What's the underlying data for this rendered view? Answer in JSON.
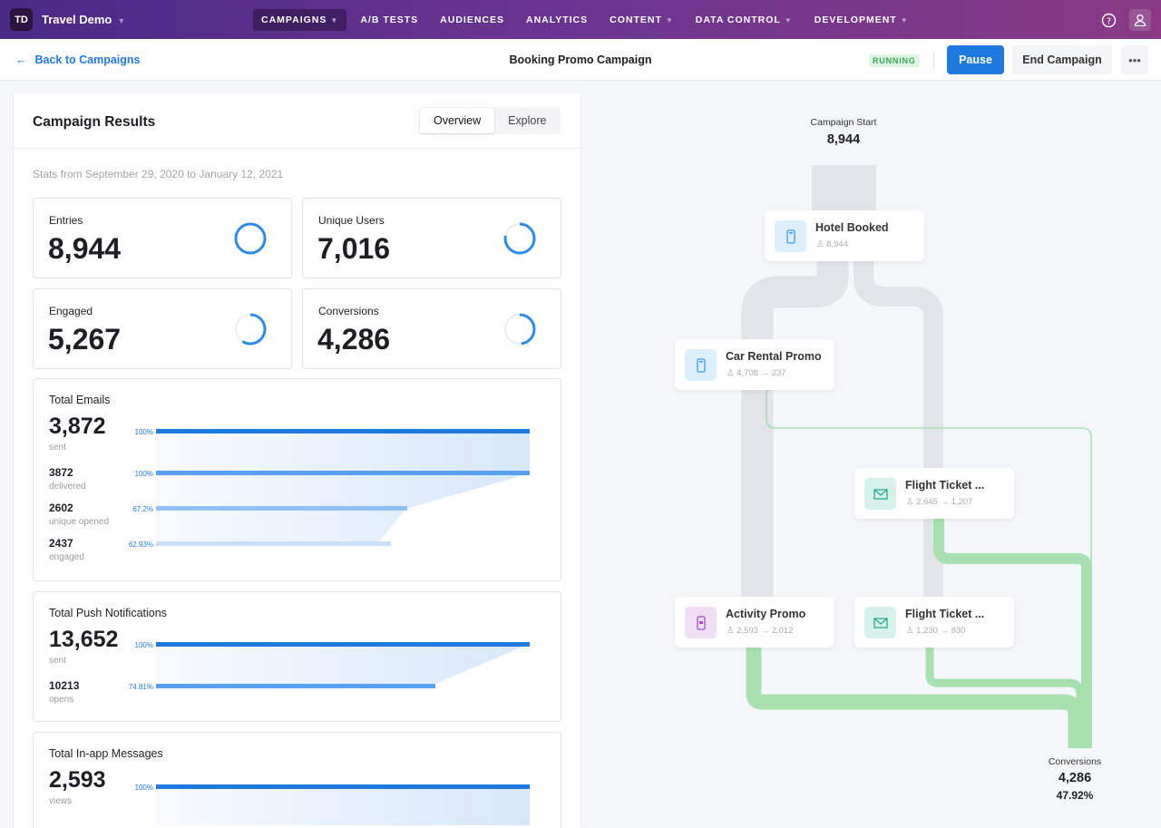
{
  "topbar": {
    "logo": "TD",
    "app": "Travel Demo",
    "nav": [
      "CAMPAIGNS",
      "A/B TESTS",
      "AUDIENCES",
      "ANALYTICS",
      "CONTENT",
      "DATA CONTROL",
      "DEVELOPMENT"
    ],
    "nav_dropdowns": [
      true,
      false,
      false,
      false,
      true,
      true,
      true
    ]
  },
  "subbar": {
    "back": "Back to Campaigns",
    "title": "Booking Promo Campaign",
    "status": "RUNNING",
    "pause": "Pause",
    "end": "End Campaign"
  },
  "panel": {
    "title": "Campaign Results",
    "tabs": [
      "Overview",
      "Explore"
    ],
    "stats": "Stats from September 29, 2020 to January 12, 2021",
    "kpis": [
      {
        "label": "Entries",
        "value": "8,944",
        "ring": 1.0
      },
      {
        "label": "Unique Users",
        "value": "7,016",
        "ring": 0.78
      },
      {
        "label": "Engaged",
        "value": "5,267",
        "ring": 0.59
      },
      {
        "label": "Conversions",
        "value": "4,286",
        "ring": 0.48
      }
    ],
    "emails": {
      "title": "Total Emails",
      "value": "3,872",
      "caption": "sent",
      "sent_pct": "100%",
      "rows": [
        {
          "value": "3872",
          "caption": "delivered",
          "pct": "100%",
          "fraction": 1.0
        },
        {
          "value": "2602",
          "caption": "unique opened",
          "pct": "67.2%",
          "fraction": 0.672
        },
        {
          "value": "2437",
          "caption": "engaged",
          "pct": "62.93%",
          "fraction": 0.6293
        }
      ]
    },
    "push": {
      "title": "Total Push Notifications",
      "value": "13,652",
      "caption": "sent",
      "sent_pct": "100%",
      "rows": [
        {
          "value": "10213",
          "caption": "opens",
          "pct": "74.81%",
          "fraction": 0.7481
        }
      ]
    },
    "inapp": {
      "title": "Total In-app Messages",
      "value": "2,593",
      "caption": "views",
      "sent_pct": "100%"
    }
  },
  "flow": {
    "start_label": "Campaign Start",
    "start_value": "8,944",
    "nodes": [
      {
        "name": "Hotel Booked",
        "metric": "8,944"
      },
      {
        "name": "Car Rental Promo",
        "metric": "4,708 → 237"
      },
      {
        "name": "Flight Ticket ...",
        "metric": "2,645 → 1,207"
      },
      {
        "name": "Activity Promo",
        "metric": "2,593 → 2,012"
      },
      {
        "name": "Flight Ticket ...",
        "metric": "1,230 → 830"
      }
    ],
    "end_label": "Conversions",
    "end_value": "4,286",
    "end_pct": "47.92%"
  },
  "colors": {
    "accent": "#1f7ae0",
    "flow_gray": "#e1e4e8",
    "flow_green": "#a8e0b0"
  }
}
